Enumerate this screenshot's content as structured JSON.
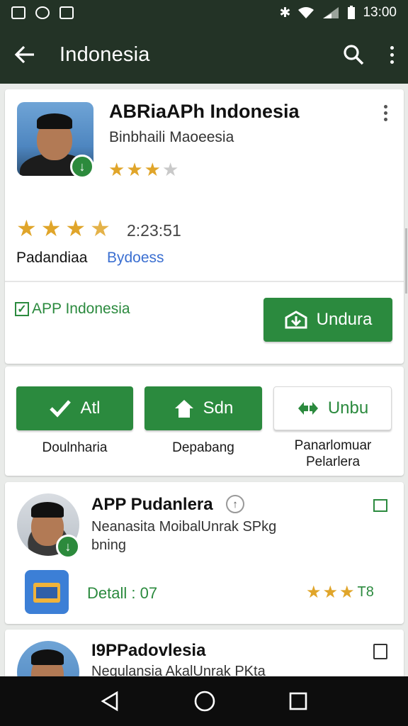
{
  "status": {
    "time": "13:00"
  },
  "appbar": {
    "title": "Indonesia"
  },
  "app_card": {
    "title": "ABRiaAPh Indonesia",
    "subtitle": "Binbhaili Maoeesia",
    "small_rating_stars": 3.5,
    "large_rating_stars": 4.5,
    "rating_count": "2:23:51",
    "category": "Padandiaa",
    "developer_link": "Bydoess",
    "checkbox_label": "APP Indonesia",
    "install_button": "Undura"
  },
  "actions": [
    {
      "label": "Atl",
      "caption": "Doulnharia",
      "style": "filled",
      "icon": "check-icon"
    },
    {
      "label": "Sdn",
      "caption": "Depabang",
      "style": "filled",
      "icon": "home-icon"
    },
    {
      "label": "Unbu",
      "caption": "Panarlomuar Pelarlera",
      "style": "outline",
      "icon": "swap-icon"
    }
  ],
  "list": [
    {
      "title": "APP Pudanlera",
      "desc_line1": "Neanasita MoibalUnrak SPkg",
      "desc_line2": "bning",
      "detail": "Detall : 07",
      "rating_text": "T8",
      "rating_stars": 3
    },
    {
      "title": "I9PPadovlesia",
      "desc_line1": "Nequlansia AkalUnrak PKta"
    }
  ],
  "colors": {
    "appbar": "#233326",
    "accent": "#2b8a3e",
    "star": "#e0a52a",
    "link": "#3b6fd1"
  }
}
